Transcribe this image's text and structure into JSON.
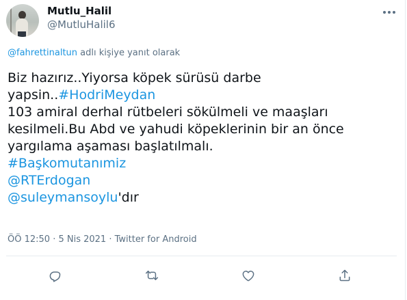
{
  "author": {
    "display_name": "Mutlu_Halil",
    "handle": "@MutluHalil6"
  },
  "reply_to": {
    "mention": "@fahrettinaltun",
    "suffix": " adlı kişiye yanıt olarak"
  },
  "tweet": {
    "line1": "Biz hazırız..Yiyorsa köpek sürüsü darbe",
    "line2_text": "yapsin..",
    "line2_hashtag": "#HodriMeydan",
    "line3": "103 amiral derhal rütbeleri sökülmeli ve maaşları",
    "line4": "kesilmeli.Bu Abd ve yahudi köpeklerinin bir an önce",
    "line5": "yargılama aşaması başlatılmalı.",
    "hashtag2": "#Başkomutanımiz",
    "mention1": "@RTErdogan",
    "mention2": "@suleymansoylu",
    "mention2_suffix": "'dır"
  },
  "meta": {
    "time": "ÖÖ 12:50",
    "separator1": " · ",
    "date": "5 Nis 2021",
    "separator2": " · ",
    "source": "Twitter for Android"
  },
  "colors": {
    "link": "#1b95e0",
    "secondary": "#5b7083",
    "divider": "#e6ecf0"
  },
  "icons": [
    "more-icon",
    "reply-icon",
    "retweet-icon",
    "like-icon",
    "share-icon"
  ]
}
